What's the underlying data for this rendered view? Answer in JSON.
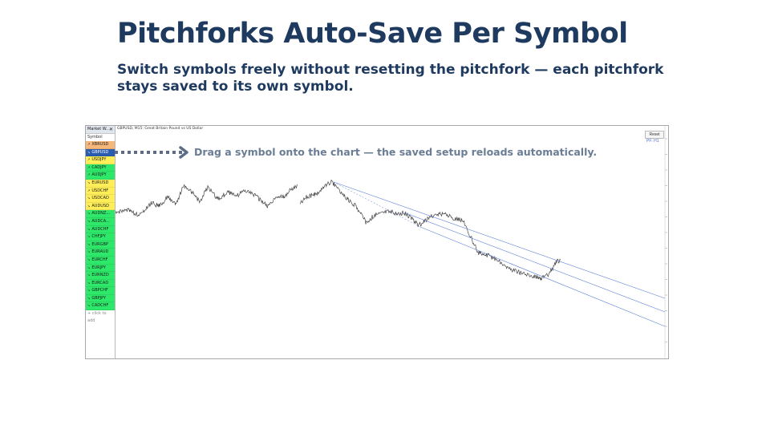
{
  "slide": {
    "title": "Pitchforks Auto-Save Per Symbol",
    "subtitle": "Switch symbols freely without resetting the pitchfork — each pitchfork stays saved to its own symbol.",
    "callout": "Drag a symbol onto the chart — the saved setup reloads automatically."
  },
  "market_watch": {
    "title": "Market W...",
    "close_glyph": "✕",
    "column_header": "Symbol",
    "add_hint": "+ click to add",
    "symbols": [
      {
        "name": "XBRUSD",
        "dir": "up",
        "bg": "#f5b87a"
      },
      {
        "name": "GBPUSD",
        "dir": "down",
        "bg": "#2a5db0",
        "selected": true
      },
      {
        "name": "USDJPY",
        "dir": "up",
        "bg": "#ffee58"
      },
      {
        "name": "CADJPY",
        "dir": "up",
        "bg": "#2ee86a"
      },
      {
        "name": "AUDJPY",
        "dir": "up",
        "bg": "#2ee86a"
      },
      {
        "name": "EURUSD",
        "dir": "down",
        "bg": "#ffee58"
      },
      {
        "name": "USDCHF",
        "dir": "up",
        "bg": "#ffee58"
      },
      {
        "name": "USDCAD",
        "dir": "down",
        "bg": "#ffee58"
      },
      {
        "name": "AUDUSD",
        "dir": "down",
        "bg": "#ffee58"
      },
      {
        "name": "AUDNZ...",
        "dir": "down",
        "bg": "#2ee86a"
      },
      {
        "name": "AUDCA...",
        "dir": "down",
        "bg": "#2ee86a"
      },
      {
        "name": "AUDCHF",
        "dir": "down",
        "bg": "#2ee86a"
      },
      {
        "name": "CHFJPY",
        "dir": "down",
        "bg": "#2ee86a"
      },
      {
        "name": "EURGBP",
        "dir": "down",
        "bg": "#2ee86a"
      },
      {
        "name": "EURAUD",
        "dir": "down",
        "bg": "#2ee86a"
      },
      {
        "name": "EURCHF",
        "dir": "down",
        "bg": "#2ee86a"
      },
      {
        "name": "EURJPY",
        "dir": "down",
        "bg": "#2ee86a"
      },
      {
        "name": "EURNZD",
        "dir": "down",
        "bg": "#2ee86a"
      },
      {
        "name": "EURCAD",
        "dir": "down",
        "bg": "#2ee86a"
      },
      {
        "name": "GBPCHF",
        "dir": "down",
        "bg": "#2ee86a"
      },
      {
        "name": "GBPJPY",
        "dir": "down",
        "bg": "#2ee86a"
      },
      {
        "name": "CADCHF",
        "dir": "down",
        "bg": "#2ee86a"
      }
    ]
  },
  "chart": {
    "header": "GBPUSD, M15: Great Britain Pound vs US Dollar",
    "reset_label": "Reset",
    "timeframe_label": "PF: H1",
    "price_scale": [
      "1.37920",
      "1.37380",
      "1.36840",
      "1.36300",
      "1.35760",
      "1.35220",
      "1.34680",
      "1.34140",
      "1.33600",
      "1.33060",
      "1.32520",
      "1.31980",
      "1.31440",
      "1.30900"
    ],
    "colors": {
      "price_line": "#444444",
      "pitchfork": "#5b7fd6",
      "callout_arrow": "#5b6d88"
    }
  }
}
